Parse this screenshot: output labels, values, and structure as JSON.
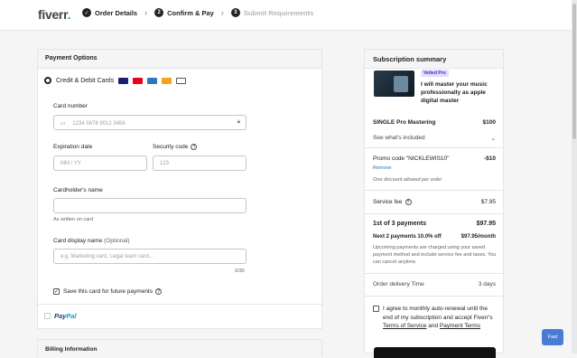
{
  "header": {
    "logo_text": "fiverr",
    "logo_dot": ".",
    "steps": [
      {
        "num": "✓",
        "label": "Order Details"
      },
      {
        "num": "2",
        "label": "Confirm & Pay"
      },
      {
        "num": "3",
        "label": "Submit Requirements"
      }
    ]
  },
  "payment": {
    "title": "Payment Options",
    "method_label": "Credit & Debit Cards",
    "card_number_label": "Card number",
    "card_number_placeholder": "1234 5678 9012 3456",
    "expiration_label": "Expiration date",
    "expiration_placeholder": "MM / YY",
    "security_label": "Security code",
    "security_placeholder": "123",
    "holder_label": "Cardholder's name",
    "holder_hint": "As written on card",
    "display_label": "Card display name",
    "display_optional": "(Optional)",
    "display_placeholder": "e.g. Marketing card, Legal team card...",
    "display_counter": "0/30",
    "save_label": "Save this card for future payments",
    "paypal_label_pay": "Pay",
    "paypal_label_pal": "Pal"
  },
  "billing": {
    "title": "Billing Information"
  },
  "summary": {
    "title": "Subscription summary",
    "badge": "Vetted Pro",
    "gig_title": "I will master your music professionally as apple digital master",
    "package_name": "SINGLE Pro Mastering",
    "package_price": "$100",
    "whats_included": "See what's included",
    "promo_label": "Promo code \"NICKLEWIS10\"",
    "promo_value": "-$10",
    "remove": "Remove",
    "promo_note": "One discount allowed per order",
    "service_fee_label": "Service fee",
    "service_fee_value": "$7.95",
    "payments_label": "1st of 3 payments",
    "payments_value": "$97.95",
    "next_label": "Next 2 payments 10.0% off",
    "next_value": "$97.95/month",
    "upcoming_note": "Upcoming payments are charged using your saved payment method and include service fee and taxes. You can cancel anytime.",
    "delivery_label": "Order delivery Time",
    "delivery_value": "3 days",
    "agree_text_1": "I agree to monthly auto-renewal until the end of my subscription and accept Fiverr's",
    "tos": "Terms of Service",
    "and": "and",
    "payment_terms": "Payment Terms"
  },
  "fast_button": "Fast",
  "colors": {
    "brand": "#1dbf73",
    "link": "#1d72c8",
    "badge_bg": "#e5dcff"
  }
}
